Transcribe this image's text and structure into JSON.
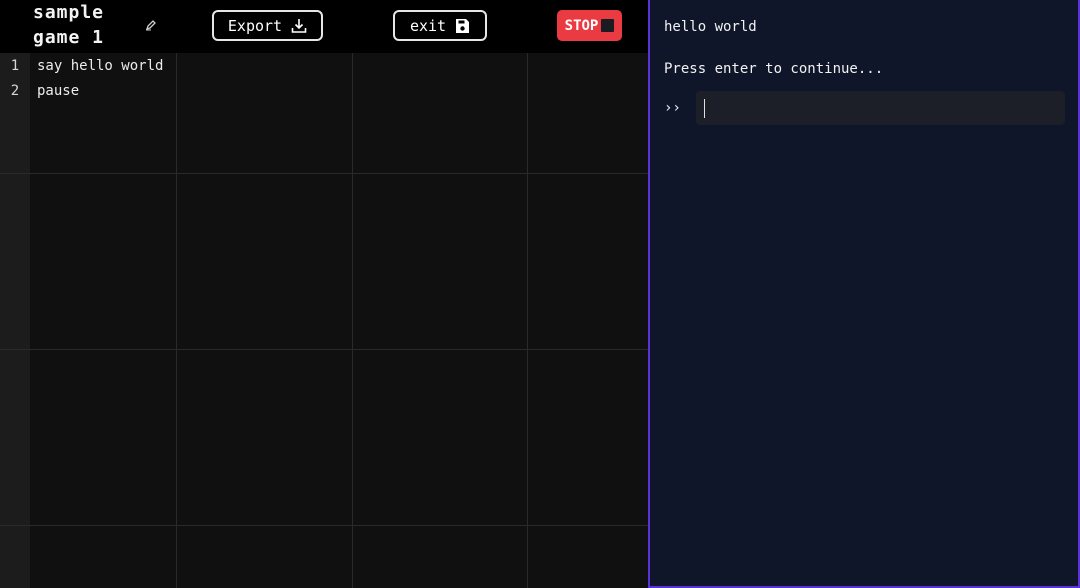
{
  "header": {
    "title": "sample game 1",
    "export_label": "Export",
    "exit_label": "exit",
    "stop_label": "STOP"
  },
  "icons": {
    "edit": "pencil-icon",
    "export": "download-icon",
    "exit": "save-icon",
    "stop": "stop-square-icon"
  },
  "editor": {
    "lines": [
      {
        "num": "1",
        "code": "say hello world"
      },
      {
        "num": "2",
        "code": "pause"
      }
    ]
  },
  "console": {
    "output": [
      "hello world",
      "Press enter to continue..."
    ],
    "prompt": "››",
    "input_value": ""
  },
  "colors": {
    "stop_button": "#ea3b43",
    "console_background": "#0f162a",
    "console_border": "#5a32d6",
    "editor_background": "#101010"
  }
}
